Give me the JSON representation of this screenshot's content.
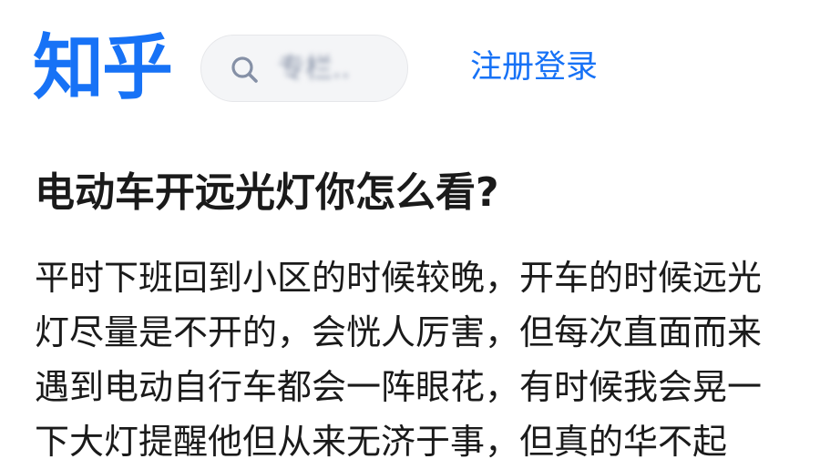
{
  "header": {
    "logo_text": "知乎",
    "search": {
      "text": "专栏.."
    },
    "login_label": "注册登录"
  },
  "question": {
    "title": "电动车开远光灯你怎么看?"
  },
  "answer": {
    "lines": [
      "平时下班回到小区的时候较晚，开车的时候远光",
      "灯尽量是不开的，会恍人厉害，但每次直面而来",
      "遇到电动自行车都会一阵眼花，有时候我会晃一",
      "下大灯提醒他但从来无济于事，但真的华不起"
    ]
  },
  "icons": {
    "search": "search-icon"
  },
  "colors": {
    "brand": "#1772f6",
    "text": "#1a1a1a",
    "search_bg": "#f4f5f7",
    "muted": "#8590a6"
  }
}
